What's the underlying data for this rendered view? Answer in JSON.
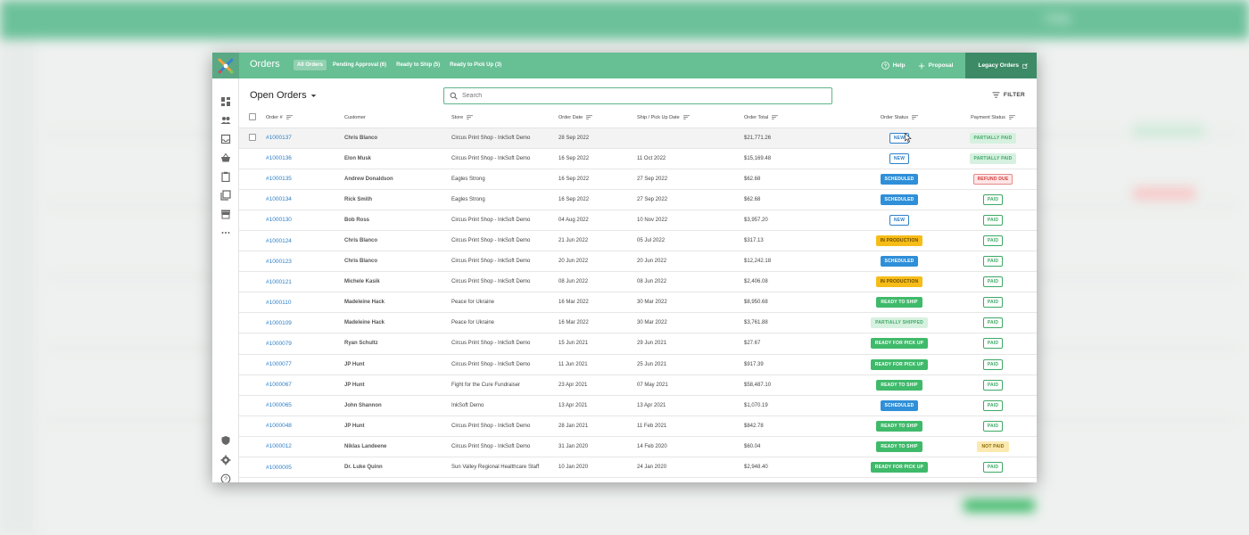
{
  "app": {
    "title": "Orders",
    "tabs": [
      {
        "label": "All Orders",
        "active": true
      },
      {
        "label": "Pending Approval (6)",
        "active": false
      },
      {
        "label": "Ready to Ship (5)",
        "active": false
      },
      {
        "label": "Ready to Pick Up (3)",
        "active": false
      }
    ],
    "help_label": "Help",
    "proposal_label": "Proposal",
    "legacy_label": "Legacy Orders",
    "backdrop_help": "Help"
  },
  "colors": {
    "brand": "#67bf94",
    "brand_dark": "#3c8a66",
    "link": "#2f80c9"
  },
  "page": {
    "heading": "Open Orders",
    "search_placeholder": "Search",
    "filter_label": "FILTER"
  },
  "columns": [
    "Order #",
    "Customer",
    "Store",
    "Order Date",
    "Ship / Pick Up Date",
    "Order Total",
    "Order Status",
    "Payment Status"
  ],
  "orders": [
    {
      "id": "#1000137",
      "customer": "Chris Blanco",
      "store": "Circus Print Shop - InkSoft Demo",
      "order_date": "28 Sep 2022",
      "ship_date": "",
      "total": "$21,771.26",
      "status": "NEW",
      "status_kind": "new",
      "payment": "PARTIALLY PAID",
      "payment_kind": "partial"
    },
    {
      "id": "#1000136",
      "customer": "Elon Musk",
      "store": "Circus Print Shop - InkSoft Demo",
      "order_date": "16 Sep 2022",
      "ship_date": "11 Oct 2022",
      "total": "$15,169.48",
      "status": "NEW",
      "status_kind": "new",
      "payment": "PARTIALLY PAID",
      "payment_kind": "partial"
    },
    {
      "id": "#1000135",
      "customer": "Andrew Donaldson",
      "store": "Eagles Strong",
      "order_date": "16 Sep 2022",
      "ship_date": "27 Sep 2022",
      "total": "$62.68",
      "status": "SCHEDULED",
      "status_kind": "sched",
      "payment": "REFUND DUE",
      "payment_kind": "refund"
    },
    {
      "id": "#1000134",
      "customer": "Rick Smith",
      "store": "Eagles Strong",
      "order_date": "16 Sep 2022",
      "ship_date": "27 Sep 2022",
      "total": "$62.68",
      "status": "SCHEDULED",
      "status_kind": "sched",
      "payment": "PAID",
      "payment_kind": "paid"
    },
    {
      "id": "#1000130",
      "customer": "Bob Ross",
      "store": "Circus Print Shop - InkSoft Demo",
      "order_date": "04 Aug 2022",
      "ship_date": "10 Nov 2022",
      "total": "$3,957.20",
      "status": "NEW",
      "status_kind": "new",
      "payment": "PAID",
      "payment_kind": "paid"
    },
    {
      "id": "#1000124",
      "customer": "Chris Blanco",
      "store": "Circus Print Shop - InkSoft Demo",
      "order_date": "21 Jun 2022",
      "ship_date": "05 Jul 2022",
      "total": "$317.13",
      "status": "IN PRODUCTION",
      "status_kind": "prod",
      "payment": "PAID",
      "payment_kind": "paid"
    },
    {
      "id": "#1000123",
      "customer": "Chris Blanco",
      "store": "Circus Print Shop - InkSoft Demo",
      "order_date": "20 Jun 2022",
      "ship_date": "20 Jun 2022",
      "total": "$12,242.18",
      "status": "SCHEDULED",
      "status_kind": "sched",
      "payment": "PAID",
      "payment_kind": "paid"
    },
    {
      "id": "#1000121",
      "customer": "Michele Kasik",
      "store": "Circus Print Shop - InkSoft Demo",
      "order_date": "08 Jun 2022",
      "ship_date": "08 Jun 2022",
      "total": "$2,406.08",
      "status": "IN PRODUCTION",
      "status_kind": "prod",
      "payment": "PAID",
      "payment_kind": "paid"
    },
    {
      "id": "#1000110",
      "customer": "Madeleine Hack",
      "store": "Peace for Ukraine",
      "order_date": "16 Mar 2022",
      "ship_date": "30 Mar 2022",
      "total": "$8,950.68",
      "status": "READY TO SHIP",
      "status_kind": "ship",
      "payment": "PAID",
      "payment_kind": "paid"
    },
    {
      "id": "#1000109",
      "customer": "Madeleine Hack",
      "store": "Peace for Ukraine",
      "order_date": "16 Mar 2022",
      "ship_date": "30 Mar 2022",
      "total": "$3,761.88",
      "status": "PARTIALLY SHIPPED",
      "status_kind": "pship",
      "payment": "PAID",
      "payment_kind": "paid"
    },
    {
      "id": "#1000079",
      "customer": "Ryan Schultz",
      "store": "Circus Print Shop - InkSoft Demo",
      "order_date": "15 Jun 2021",
      "ship_date": "29 Jun 2021",
      "total": "$27.67",
      "status": "READY FOR PICK UP",
      "status_kind": "pickup",
      "payment": "PAID",
      "payment_kind": "paid"
    },
    {
      "id": "#1000077",
      "customer": "JP Hunt",
      "store": "Circus Print Shop - InkSoft Demo",
      "order_date": "11 Jun 2021",
      "ship_date": "25 Jun 2021",
      "total": "$917.39",
      "status": "READY FOR PICK UP",
      "status_kind": "pickup",
      "payment": "PAID",
      "payment_kind": "paid"
    },
    {
      "id": "#1000067",
      "customer": "JP Hunt",
      "store": "Fight for the Cure Fundraiser",
      "order_date": "23 Apr 2021",
      "ship_date": "07 May 2021",
      "total": "$58,487.10",
      "status": "READY TO SHIP",
      "status_kind": "ship",
      "payment": "PAID",
      "payment_kind": "paid"
    },
    {
      "id": "#1000065",
      "customer": "John Shannon",
      "store": "InkSoft Demo",
      "order_date": "13 Apr 2021",
      "ship_date": "13 Apr 2021",
      "total": "$1,070.19",
      "status": "SCHEDULED",
      "status_kind": "sched",
      "payment": "PAID",
      "payment_kind": "paid"
    },
    {
      "id": "#1000048",
      "customer": "JP Hunt",
      "store": "Circus Print Shop - InkSoft Demo",
      "order_date": "28 Jan 2021",
      "ship_date": "11 Feb 2021",
      "total": "$842.78",
      "status": "READY TO SHIP",
      "status_kind": "ship",
      "payment": "PAID",
      "payment_kind": "paid"
    },
    {
      "id": "#1000012",
      "customer": "Niklas Landeene",
      "store": "Circus Print Shop - InkSoft Demo",
      "order_date": "31 Jan 2020",
      "ship_date": "14 Feb 2020",
      "total": "$60.04",
      "status": "READY TO SHIP",
      "status_kind": "ship",
      "payment": "NOT PAID",
      "payment_kind": "notpaid"
    },
    {
      "id": "#1000005",
      "customer": "Dr. Luke Quinn",
      "store": "Sun Valley Regional Healthcare Staff",
      "order_date": "10 Jan 2020",
      "ship_date": "24 Jan 2020",
      "total": "$2,948.40",
      "status": "READY FOR PICK UP",
      "status_kind": "pickup",
      "payment": "PAID",
      "payment_kind": "paid"
    }
  ],
  "sidenav_icons": [
    "dashboard-icon",
    "customers-icon",
    "inbox-icon",
    "basket-icon",
    "clipboard-icon",
    "catalog-icon",
    "store-icon",
    "more-icon",
    "shield-icon",
    "settings-icon",
    "help-icon"
  ]
}
